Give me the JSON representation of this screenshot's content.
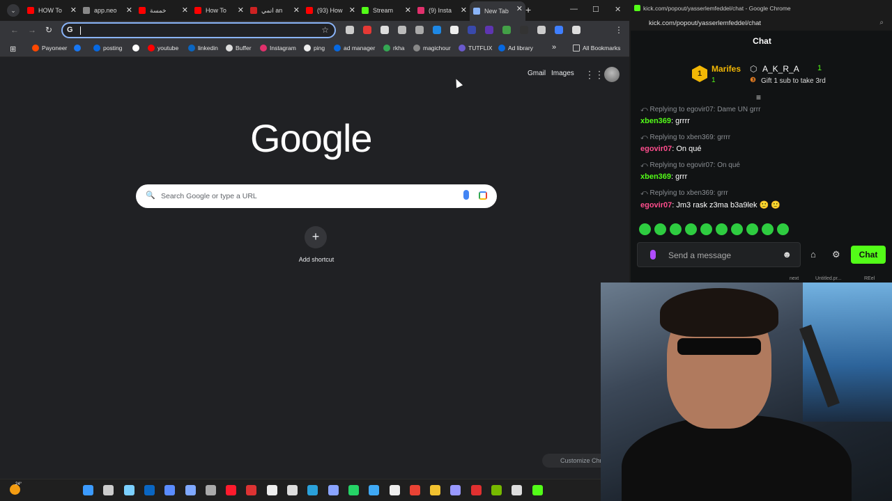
{
  "browser": {
    "tabs": [
      {
        "label": "HOW To",
        "color": "#ff0000"
      },
      {
        "label": "app.neo",
        "color": "#888888"
      },
      {
        "label": "خمسة",
        "color": "#ff0000"
      },
      {
        "label": "How To",
        "color": "#ff0000"
      },
      {
        "label": "اتمي an",
        "color": "#cc2222"
      },
      {
        "label": "(93) How",
        "color": "#ff0000"
      },
      {
        "label": "Stream",
        "color": "#53fc18"
      },
      {
        "label": "(9) Insta",
        "color": "#e1306c"
      },
      {
        "label": "New Tab",
        "color": "#8ab4f8"
      }
    ],
    "omnibox_value": "",
    "bookmarks": [
      {
        "label": "Payoneer",
        "color": "#ff4800"
      },
      {
        "label": "",
        "color": "#1877f2"
      },
      {
        "label": "posting",
        "color": "#0668e1"
      },
      {
        "label": "",
        "color": "#ffffff"
      },
      {
        "label": "youtube",
        "color": "#ff0000"
      },
      {
        "label": "linkedin",
        "color": "#0a66c2"
      },
      {
        "label": "Buffer",
        "color": "#dddddd"
      },
      {
        "label": "Instagram",
        "color": "#e1306c"
      },
      {
        "label": "ping",
        "color": "#eeeeee"
      },
      {
        "label": "ad manager",
        "color": "#0668e1"
      },
      {
        "label": "rkha",
        "color": "#34a853"
      },
      {
        "label": "magichour",
        "color": "#888888"
      },
      {
        "label": "TUTFLIX",
        "color": "#6a5acd"
      },
      {
        "label": "Ad library",
        "color": "#0668e1"
      }
    ],
    "all_bookmarks": "All Bookmarks",
    "overflow": "»"
  },
  "google": {
    "gmail": "Gmail",
    "images": "Images",
    "logo": "Google",
    "search_placeholder": "Search Google or type a URL",
    "add_shortcut": "Add shortcut",
    "customize": "Customize Chr"
  },
  "kick": {
    "window_title": "kick.com/popout/yasserlemfeddel/chat - Google Chrome",
    "url": "kick.com/popout/yasserlemfeddel/chat",
    "header": "Chat",
    "leaderboard": {
      "rank": "1",
      "first_name": "Marifes",
      "first_count": "1",
      "second_name": "A_K_R_A",
      "second_count": "1",
      "gift_text": "Gift 1 sub to take 3rd"
    },
    "messages": [
      {
        "reply": "Replying to egovir07: Dame UN grrr",
        "user": "xben369",
        "text": "grrrr",
        "color": "#53fc18"
      },
      {
        "reply": "Replying to xben369: grrrr",
        "user": "egovir07",
        "text": "On qué",
        "color": "#ff4d8d"
      },
      {
        "reply": "Replying to egovir07: On qué",
        "user": "xben369",
        "text": "grrr",
        "color": "#53fc18"
      },
      {
        "reply": "Replying to xben369: grrr",
        "user": "egovir07",
        "text": "Jm3 rask z3ma b3a9lek 🙂 🙂",
        "color": "#ff4d8d"
      }
    ],
    "message_placeholder": "Send a message",
    "chat_button": "Chat",
    "taskbar_labels": [
      "next",
      "Untitled.pr...",
      "REel"
    ]
  },
  "taskbar": {
    "temp": "24°",
    "icons": [
      {
        "name": "windows-icon",
        "color": "#3c9bff"
      },
      {
        "name": "task-view-icon",
        "color": "#cccccc"
      },
      {
        "name": "copilot-icon",
        "color": "#7bd0ff"
      },
      {
        "name": "linkedin-app-icon",
        "color": "#0a66c2"
      },
      {
        "name": "app-icon-1",
        "color": "#5a8cff"
      },
      {
        "name": "app-icon-2",
        "color": "#7fa8ff"
      },
      {
        "name": "settings-icon",
        "color": "#aaaaaa"
      },
      {
        "name": "opera-icon",
        "color": "#ff1b2d"
      },
      {
        "name": "app-icon-3",
        "color": "#d33"
      },
      {
        "name": "tiktok-icon",
        "color": "#eeeeee"
      },
      {
        "name": "app-icon-4",
        "color": "#dddddd"
      },
      {
        "name": "telegram-icon",
        "color": "#2aa1da"
      },
      {
        "name": "app-icon-5",
        "color": "#8aa4ff"
      },
      {
        "name": "whatsapp-icon",
        "color": "#25d366"
      },
      {
        "name": "app-icon-6",
        "color": "#3fa9f5"
      },
      {
        "name": "notion-icon",
        "color": "#eeeeee"
      },
      {
        "name": "chrome-icon",
        "color": "#ea4335"
      },
      {
        "name": "folder-icon",
        "color": "#f2c230"
      },
      {
        "name": "premiere-icon",
        "color": "#9999ff"
      },
      {
        "name": "app-icon-7",
        "color": "#e03030"
      },
      {
        "name": "nvidia-icon",
        "color": "#76b900"
      },
      {
        "name": "app-icon-8",
        "color": "#dddddd"
      },
      {
        "name": "app-icon-9",
        "color": "#53fc18"
      }
    ]
  }
}
